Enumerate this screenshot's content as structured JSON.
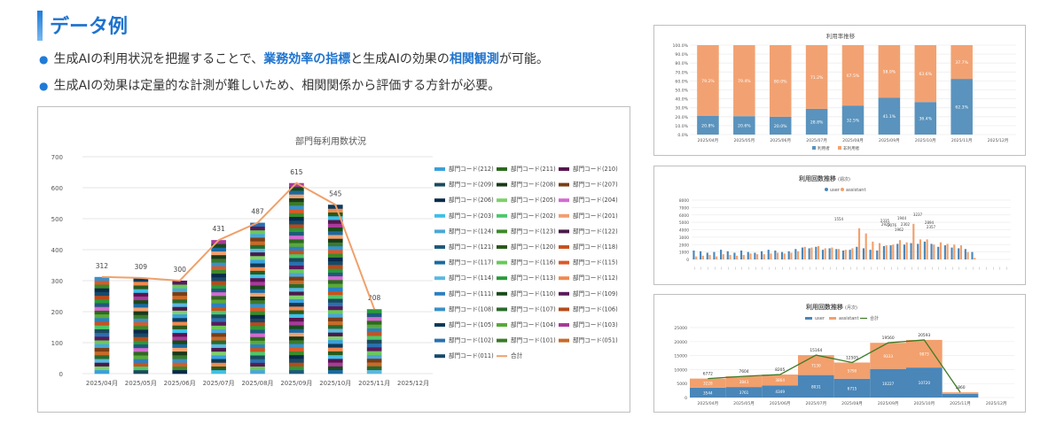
{
  "header": {
    "title": "データ例",
    "bullet1_pre": "生成AIの利用状況を把握することで、",
    "bullet1_hl1": "業務効率の指標",
    "bullet1_mid": "と生成AIの効果の",
    "bullet1_hl2": "相関観測",
    "bullet1_post": "が可能。",
    "bullet2": "生成AIの効果は定量的な計測が難しいため、相関関係から評価する方針が必要。"
  },
  "colors": {
    "accent": "#1f74cf",
    "total_line": "#f0a06b",
    "user": "#4a86b8",
    "assistant": "#f2a06d",
    "month_line": "#3d7a26"
  },
  "chart_data": [
    {
      "type": "bar",
      "stacked": true,
      "title": "部門毎利用数状況",
      "categories": [
        "2025/04月",
        "2025/05月",
        "2025/06月",
        "2025/07月",
        "2025/08月",
        "2025/09月",
        "2025/10月",
        "2025/11月",
        "2025/12月"
      ],
      "totals": [
        312,
        309,
        300,
        431,
        487,
        615,
        545,
        208,
        null
      ],
      "ylim": [
        0,
        700
      ],
      "yticks": [
        0,
        100,
        200,
        300,
        400,
        500,
        600,
        700
      ],
      "legend": [
        "部門コード(212)",
        "部門コード(211)",
        "部門コード(210)",
        "部門コード(209)",
        "部門コード(208)",
        "部門コード(207)",
        "部門コード(206)",
        "部門コード(205)",
        "部門コード(204)",
        "部門コード(203)",
        "部門コード(202)",
        "部門コード(201)",
        "部門コード(124)",
        "部門コード(123)",
        "部門コード(122)",
        "部門コード(121)",
        "部門コード(120)",
        "部門コード(118)",
        "部門コード(117)",
        "部門コード(116)",
        "部門コード(115)",
        "部門コード(114)",
        "部門コード(113)",
        "部門コード(112)",
        "部門コード(111)",
        "部門コード(110)",
        "部門コード(109)",
        "部門コード(108)",
        "部門コード(107)",
        "部門コード(106)",
        "部門コード(105)",
        "部門コード(104)",
        "部門コード(103)",
        "部門コード(102)",
        "部門コード(101)",
        "部門コード(051)",
        "部門コード(011)",
        "合計"
      ],
      "legend_colors": [
        "#3aa0dc",
        "#2d6a1f",
        "#5a1450",
        "#1b4b5c",
        "#1a3a1a",
        "#7a3e16",
        "#0b2a4a",
        "#7fd06c",
        "#d46ad0",
        "#3ec0e8",
        "#4cc86a",
        "#f0a070",
        "#4aa6d8",
        "#3d8a2a",
        "#4a1a4a",
        "#1e5a7a",
        "#2a5a1a",
        "#c8521e",
        "#1a6aa0",
        "#6ac85a",
        "#d85a2a",
        "#5ab8e0",
        "#2a9a3a",
        "#f08a50",
        "#2a80c0",
        "#1a4a1a",
        "#5a1a5a",
        "#3a90c8",
        "#2a6a2a",
        "#b84a1a",
        "#0e3a5a",
        "#5aa83a",
        "#a83a9a",
        "#2a70b0",
        "#3a7a2a",
        "#c86a2a",
        "#164a6a",
        "#f0a06b"
      ],
      "legend_types": [
        "bar",
        "bar",
        "bar",
        "bar",
        "bar",
        "bar",
        "bar",
        "bar",
        "bar",
        "bar",
        "bar",
        "bar",
        "bar",
        "bar",
        "bar",
        "bar",
        "bar",
        "bar",
        "bar",
        "bar",
        "bar",
        "bar",
        "bar",
        "bar",
        "bar",
        "bar",
        "bar",
        "bar",
        "bar",
        "bar",
        "bar",
        "bar",
        "bar",
        "bar",
        "bar",
        "bar",
        "bar",
        "line"
      ]
    },
    {
      "type": "bar",
      "stacked": true,
      "percent": true,
      "title": "利用率推移",
      "categories": [
        "2025/04月",
        "2025/05月",
        "2025/06月",
        "2025/07月",
        "2025/08月",
        "2025/09月",
        "2025/10月",
        "2025/11月",
        "2025/12月"
      ],
      "series": [
        {
          "name": "利用者",
          "values": [
            20.8,
            20.6,
            20.0,
            28.8,
            32.5,
            41.1,
            36.4,
            62.3,
            null
          ]
        },
        {
          "name": "非利用者",
          "values": [
            79.2,
            79.4,
            80.0,
            71.2,
            67.5,
            58.9,
            63.6,
            37.7,
            null
          ]
        }
      ],
      "labels_bottom": [
        "20.8%",
        "20.6%",
        "20.0%",
        "28.8%",
        "32.5%",
        "41.1%",
        "36.4%",
        "62.3%"
      ],
      "labels_top": [
        "79.2%",
        "79.4%",
        "80.0%",
        "71.2%",
        "67.5%",
        "58.9%",
        "63.6%",
        "37.7%"
      ],
      "yticks": [
        "0.0%",
        "10.0%",
        "20.0%",
        "30.0%",
        "40.0%",
        "50.0%",
        "60.0%",
        "70.0%",
        "80.0%",
        "90.0%",
        "100.0%"
      ]
    },
    {
      "type": "bar",
      "title": "利用回数推移",
      "title_suffix": "(週次)",
      "series_names": [
        "user",
        "assistant"
      ],
      "yticks": [
        "0",
        "1000",
        "2000",
        "3000",
        "4000",
        "5000",
        "6000",
        "7000",
        "8000"
      ],
      "ylim": [
        0,
        8000
      ],
      "user": [
        1200,
        1100,
        900,
        1000,
        1300,
        1100,
        900,
        1200,
        1000,
        900,
        1100,
        1300,
        1200,
        1000,
        1100,
        1400,
        1600,
        1500,
        1700,
        1300,
        1500,
        1400,
        1200,
        1300,
        1700,
        1500,
        1300,
        1200,
        1800,
        1900,
        2100,
        2000,
        2200,
        2100,
        2400,
        2100,
        1700,
        1900,
        1600,
        1500,
        1400,
        1000,
        0,
        0,
        0,
        0,
        0
      ],
      "assistant": [
        400,
        500,
        600,
        400,
        700,
        600,
        500,
        600,
        800,
        700,
        700,
        800,
        900,
        800,
        900,
        1100,
        1700,
        1600,
        1800,
        1500,
        1600,
        1400,
        1300,
        1500,
        4200,
        3500,
        2400,
        2200,
        1900,
        2000,
        2600,
        2300,
        4800,
        2700,
        2700,
        2000,
        2300,
        2100,
        2000,
        1900,
        1000,
        200,
        0,
        0,
        0,
        0,
        0
      ],
      "value_labels": [
        "1554",
        "2335",
        "2076",
        "2925",
        "1944",
        "2302",
        "3237",
        "2894",
        "2357",
        "1962"
      ]
    },
    {
      "type": "area",
      "title": "利用回数推移",
      "title_suffix": "(月次)",
      "series_names": [
        "user",
        "assistant",
        "合計"
      ],
      "categories": [
        "2025/04月",
        "2025/05月",
        "2025/06月",
        "2025/07月",
        "2025/08月",
        "2025/09月",
        "2025/10月",
        "2025/11月",
        "2025/12月"
      ],
      "user": [
        3544,
        3761,
        4349,
        8031,
        6715,
        10227,
        10720,
        1300,
        null
      ],
      "assistant": [
        3228,
        3843,
        3864,
        7130,
        5790,
        9333,
        9873,
        560,
        null
      ],
      "total": [
        6772,
        7604,
        8205,
        15164,
        12505,
        19560,
        20593,
        1860,
        null
      ],
      "ylim": [
        0,
        25000
      ],
      "yticks": [
        "0",
        "5000",
        "10000",
        "15000",
        "20000",
        "25000"
      ]
    }
  ]
}
